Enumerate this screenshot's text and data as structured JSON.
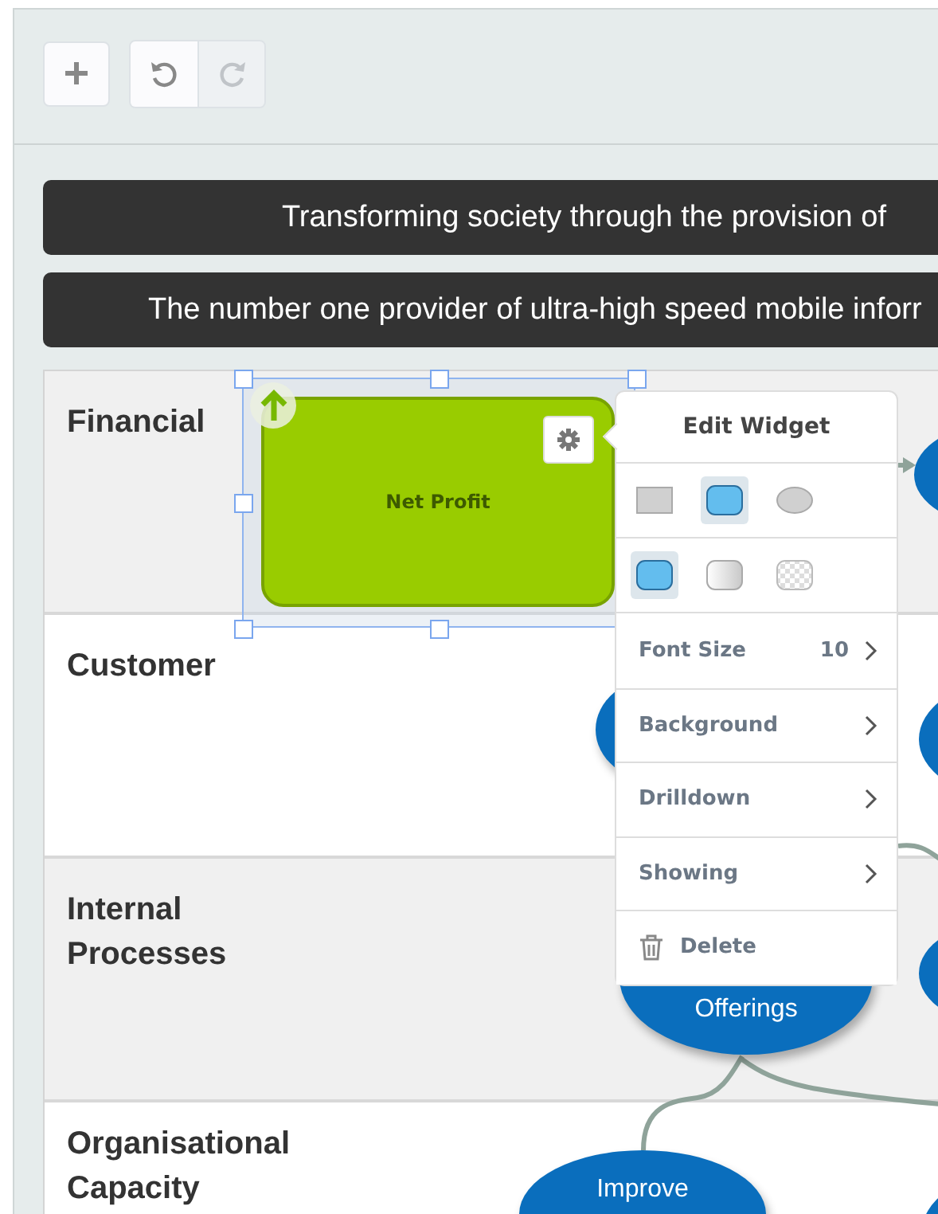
{
  "toolbar": {
    "buttons": [
      {
        "kind": "add",
        "disabled": false
      },
      {
        "kind": "undo",
        "disabled": false
      },
      {
        "kind": "redo",
        "disabled": true
      }
    ]
  },
  "banners": [
    {
      "text": "Transforming society through the provision of"
    },
    {
      "text": "The number one provider of ultra-high speed mobile inforr"
    }
  ],
  "perspectives": [
    {
      "label": "Financial"
    },
    {
      "label": "Customer"
    },
    {
      "label": "Internal Processes"
    },
    {
      "label": "Organisational Capacity"
    }
  ],
  "widget": {
    "label": "Net Profit",
    "selected": true,
    "trending_up": true
  },
  "nodes": [
    {
      "label": "Offerings"
    },
    {
      "label": "Improve"
    }
  ],
  "edit_menu": {
    "title": "Edit Widget",
    "shapes": [
      {
        "kind": "rectangle",
        "selected": false
      },
      {
        "kind": "rounded",
        "selected": true
      },
      {
        "kind": "ellipse",
        "selected": false
      }
    ],
    "fills": [
      {
        "kind": "solid",
        "selected": true
      },
      {
        "kind": "gradient",
        "selected": false
      },
      {
        "kind": "transparent",
        "selected": false
      }
    ],
    "items": [
      {
        "kind": "submenu",
        "label": "Font Size",
        "value": "10"
      },
      {
        "kind": "submenu",
        "label": "Background"
      },
      {
        "kind": "submenu",
        "label": "Drilldown"
      },
      {
        "kind": "submenu",
        "label": "Showing"
      },
      {
        "kind": "delete",
        "label": "Delete"
      }
    ]
  }
}
